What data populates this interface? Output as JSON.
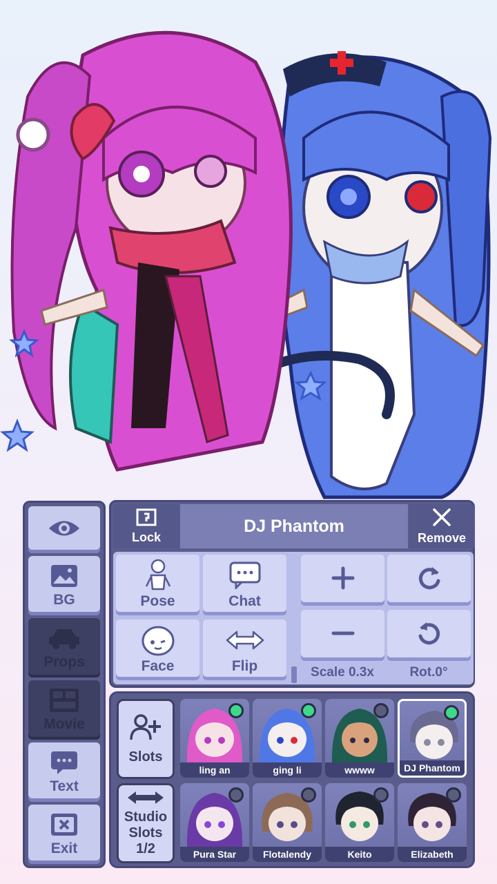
{
  "panel": {
    "lock_label": "Lock",
    "character_name": "DJ Phantom",
    "remove_label": "Remove",
    "pose_label": "Pose",
    "chat_label": "Chat",
    "face_label": "Face",
    "flip_label": "Flip",
    "scale_label": "Scale 0.3x",
    "rotation_label": "Rot.0°"
  },
  "side_menu": {
    "bg_label": "BG",
    "props_label": "Props",
    "movie_label": "Movie",
    "text_label": "Text",
    "exit_label": "Exit"
  },
  "slots": {
    "slots_label": "Slots",
    "studio_line1": "Studio",
    "studio_line2": "Slots",
    "studio_page": "1/2",
    "characters": [
      {
        "name": "ling an",
        "active": true,
        "hair": "#e05ac8"
      },
      {
        "name": "ging li",
        "active": true,
        "hair": "#4f78e6"
      },
      {
        "name": "wwww",
        "active": false,
        "hair": "#1f5d52"
      },
      {
        "name": "DJ Phantom",
        "active": true,
        "hair": "#6a6a92",
        "selected": true
      },
      {
        "name": "Pura Star",
        "active": false,
        "hair": "#6a3aa6"
      },
      {
        "name": "Flotalendy",
        "active": false,
        "hair": "#8d6a55"
      },
      {
        "name": "Keito",
        "active": false,
        "hair": "#1e2430"
      },
      {
        "name": "Elizabeth",
        "active": false,
        "hair": "#2e2436"
      }
    ]
  },
  "colors": {
    "panel": "#5a5d8c",
    "button": "#d3d6f4",
    "accent_text": "#565a94",
    "active_dot": "#3ed88a"
  }
}
